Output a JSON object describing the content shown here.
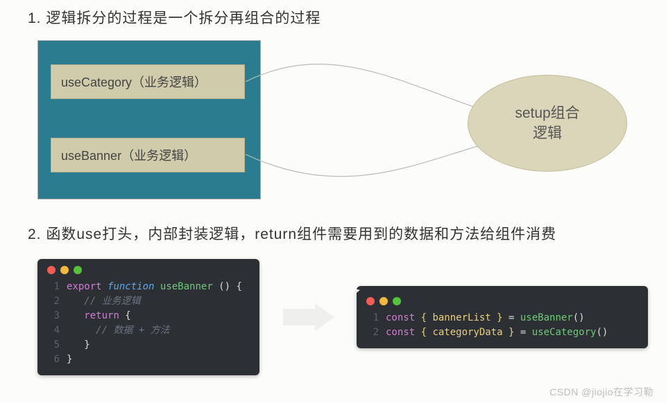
{
  "heading1": "1. 逻辑拆分的过程是一个拆分再组合的过程",
  "heading2": "2. 函数use打头，内部封装逻辑，return组件需要用到的数据和方法给组件消费",
  "box1": "useCategory（业务逻辑）",
  "box2": "useBanner（业务逻辑）",
  "ellipse_l1": "setup组合",
  "ellipse_l2": "逻辑",
  "code_left": {
    "l1_export": "export",
    "l1_function": "function",
    "l1_name": "useBanner",
    "l1_parens": " () {",
    "l2_comment": "// 业务逻辑",
    "l3_return": "return",
    "l3_brace": " {",
    "l4_comment": "// 数据 + 方法",
    "l5_brace": "}",
    "l6_brace": "}"
  },
  "code_right": {
    "l1_const": "const",
    "l1_destr": " { bannerList } ",
    "l1_eq": "= ",
    "l1_call": "useBanner",
    "l1_end": "()",
    "l2_const": "const",
    "l2_destr": " { categoryData } ",
    "l2_eq": "= ",
    "l2_call": "useCategory",
    "l2_end": "()"
  },
  "watermark": "CSDN @jiojio在学习勒"
}
